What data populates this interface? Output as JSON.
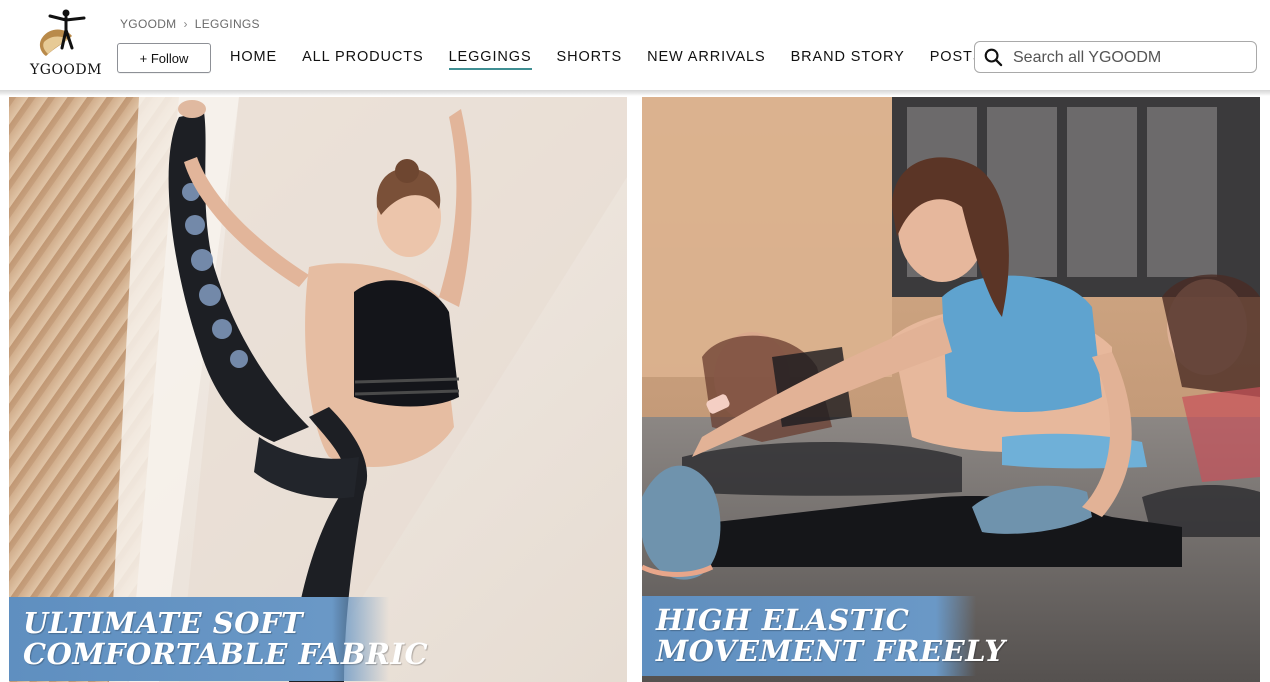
{
  "store": {
    "logo_text": "YGOODM"
  },
  "breadcrumb": {
    "store": "YGOODM",
    "separator": "›",
    "current": "LEGGINGS"
  },
  "follow_button": {
    "label": "+ Follow"
  },
  "nav": {
    "items": [
      {
        "label": "HOME",
        "active": false
      },
      {
        "label": "ALL PRODUCTS",
        "active": false
      },
      {
        "label": "LEGGINGS",
        "active": true
      },
      {
        "label": "SHORTS",
        "active": false
      },
      {
        "label": "NEW ARRIVALS",
        "active": false
      },
      {
        "label": "BRAND STORY",
        "active": false
      },
      {
        "label": "POSTS",
        "active": false
      }
    ],
    "active_underline_color": "#3f8f93"
  },
  "search": {
    "placeholder": "Search all YGOODM",
    "value": "",
    "icon": "search-icon"
  },
  "tiles": [
    {
      "banner_lines": [
        "ULTIMATE SOFT",
        "COMFORTABLE FABRIC"
      ],
      "banner_color": "#6a98c6"
    },
    {
      "banner_lines": [
        "HIGH ELASTIC",
        "MOVEMENT FREELY"
      ],
      "banner_color": "#6a98c6"
    }
  ]
}
